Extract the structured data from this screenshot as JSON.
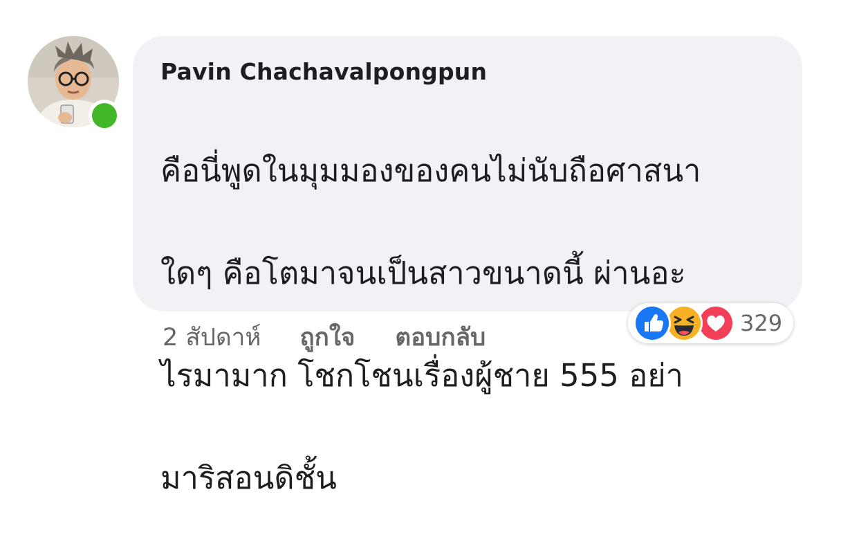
{
  "comment": {
    "author": "Pavin Chachavalpongpun",
    "text_lines": [
      "คือนี่พูดในมุมมองของคนไม่นับถือศาสนา",
      "ใดๆ คือโตมาจนเป็นสาวขนาดนี้ ผ่านอะ",
      "ไรมามาก โชกโชนเรื่องผู้ชาย 555 อย่า",
      "มาริสอนดิชั้น"
    ],
    "timestamp": "2 สัปดาห์",
    "like_label": "ถูกใจ",
    "reply_label": "ตอบกลับ",
    "reactions": {
      "icons": [
        "like-icon",
        "haha-icon",
        "love-icon"
      ],
      "count": "329"
    }
  },
  "colors": {
    "bubble": "#f0f2f5",
    "online": "#42b72a",
    "like": "#1877f2",
    "love": "#f33e58",
    "haha": "#f7b125",
    "meta_text": "#65676b"
  }
}
